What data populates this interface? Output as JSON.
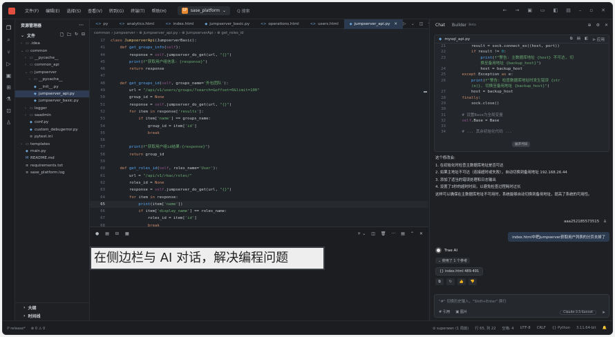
{
  "titlebar": {
    "menu": [
      "文件(F)",
      "编辑(E)",
      "选择(S)",
      "查看(V)",
      "转到(G)",
      "终端(T)",
      "帮助(H)"
    ],
    "project_initial": "SP",
    "project": "sase_platform",
    "search": "Q 搜索"
  },
  "explorer": {
    "title": "资源管理器",
    "project": "文件",
    "items": [
      {
        "label": ".idea",
        "depth": 1,
        "chev": "›",
        "icon": "folder"
      },
      {
        "label": "common",
        "depth": 1,
        "chev": "⌄",
        "icon": "folder"
      },
      {
        "label": "__pycache__",
        "depth": 2,
        "chev": "›",
        "icon": "folder"
      },
      {
        "label": "common_api",
        "depth": 2,
        "chev": "›",
        "icon": "folder"
      },
      {
        "label": "jumpserver",
        "depth": 2,
        "chev": "⌄",
        "icon": "folder"
      },
      {
        "label": "__pycache__",
        "depth": 3,
        "chev": "›",
        "icon": "folder"
      },
      {
        "label": "__init__.py",
        "depth": 3,
        "chev": "",
        "icon": "py"
      },
      {
        "label": "jumpserver_api.py",
        "depth": 3,
        "chev": "",
        "icon": "py",
        "selected": true
      },
      {
        "label": "jumpserver_basic.py",
        "depth": 3,
        "chev": "",
        "icon": "py"
      },
      {
        "label": "logger",
        "depth": 2,
        "chev": "›",
        "icon": "folder"
      },
      {
        "label": "saadmin",
        "depth": 2,
        "chev": "›",
        "icon": "folder"
      },
      {
        "label": "conf.py",
        "depth": 2,
        "chev": "",
        "icon": "py"
      },
      {
        "label": "custom_debugerror.py",
        "depth": 2,
        "chev": "",
        "icon": "py"
      },
      {
        "label": "pytest.ini",
        "depth": 2,
        "chev": "",
        "icon": "txt"
      },
      {
        "label": "templates",
        "depth": 1,
        "chev": "›",
        "icon": "folder"
      },
      {
        "label": "main.py",
        "depth": 1,
        "chev": "",
        "icon": "py"
      },
      {
        "label": "README.md",
        "depth": 1,
        "chev": "",
        "icon": "md"
      },
      {
        "label": "requirements.txt",
        "depth": 1,
        "chev": "",
        "icon": "txt"
      },
      {
        "label": "sase_platform.log",
        "depth": 1,
        "chev": "",
        "icon": "txt"
      }
    ],
    "outline": "大纲",
    "timeline": "时间线"
  },
  "editor": {
    "tabs": [
      {
        "label": "py",
        "active": false
      },
      {
        "label": "analytics.html",
        "active": false
      },
      {
        "label": "index.html",
        "active": false
      },
      {
        "label": "jumpserver_basic.py",
        "active": false
      },
      {
        "label": "operations.html",
        "active": false
      },
      {
        "label": "users.html",
        "active": false
      },
      {
        "label": "jumpserver_api.py",
        "active": true
      }
    ],
    "breadcrumb": "common › jumpserver › ⊕ jumpserver_api.py › ⊕ JumpserverApi › ⊕ get_roles_id",
    "current_line": "65",
    "lines": [
      {
        "n": "17",
        "t": [
          [
            "class ",
            "kw"
          ],
          [
            "JumpserverApi",
            "cl"
          ],
          [
            "(JumpserverBasic):",
            "ct"
          ]
        ]
      },
      {
        "n": "41",
        "t": [
          [
            "    ",
            "ct"
          ],
          [
            "def ",
            "kw"
          ],
          [
            "get_groups_info",
            "fn"
          ],
          [
            "(",
            "ct"
          ],
          [
            "self",
            "sf"
          ],
          [
            "):",
            "ct"
          ]
        ]
      },
      {
        "n": "44",
        "t": [
          [
            "        response = ",
            "ct"
          ],
          [
            "self",
            "sf"
          ],
          [
            ".jumpserver_do_get(url, ",
            "ct"
          ],
          [
            "\"{}\"",
            "st"
          ],
          [
            ")",
            "ct"
          ]
        ]
      },
      {
        "n": "45",
        "t": [
          [
            "        ",
            "ct"
          ],
          [
            "print",
            "fn"
          ],
          [
            "(",
            "ct"
          ],
          [
            "f\"获取用户组信息: {response}\"",
            "st"
          ],
          [
            ")",
            "ct"
          ]
        ]
      },
      {
        "n": "46",
        "t": [
          [
            "        ",
            "ct"
          ],
          [
            "return ",
            "kw"
          ],
          [
            "response",
            "ct"
          ]
        ]
      },
      {
        "n": "47",
        "t": [
          [
            "",
            "ct"
          ]
        ]
      },
      {
        "n": "48",
        "t": [
          [
            "    ",
            "ct"
          ],
          [
            "def ",
            "kw"
          ],
          [
            "get_groups_id",
            "fn"
          ],
          [
            "(",
            "ct"
          ],
          [
            "self",
            "sf"
          ],
          [
            ", groups_name=",
            "ct"
          ],
          [
            "'外包团队'",
            "st"
          ],
          [
            "):",
            "ct"
          ]
        ]
      },
      {
        "n": "49",
        "t": [
          [
            "        url = ",
            "ct"
          ],
          [
            "\"/api/v1/users/groups/?search=&offset=0&limit=100\"",
            "st"
          ]
        ]
      },
      {
        "n": "50",
        "t": [
          [
            "        group_id = ",
            "ct"
          ],
          [
            "None",
            "kw"
          ]
        ]
      },
      {
        "n": "51",
        "t": [
          [
            "        response = ",
            "ct"
          ],
          [
            "self",
            "sf"
          ],
          [
            ".jumpserver_do_get(url, ",
            "ct"
          ],
          [
            "\"{}\"",
            "st"
          ],
          [
            ")",
            "ct"
          ]
        ]
      },
      {
        "n": "52",
        "t": [
          [
            "        ",
            "ct"
          ],
          [
            "for ",
            "kw"
          ],
          [
            "item ",
            "ct"
          ],
          [
            "in ",
            "kw"
          ],
          [
            "response[",
            "ct"
          ],
          [
            "'results'",
            "st"
          ],
          [
            "]:",
            "ct"
          ]
        ]
      },
      {
        "n": "53",
        "t": [
          [
            "            ",
            "ct"
          ],
          [
            "if ",
            "kw"
          ],
          [
            "item[",
            "ct"
          ],
          [
            "'name'",
            "st"
          ],
          [
            "] == groups_name:",
            "ct"
          ]
        ]
      },
      {
        "n": "54",
        "t": [
          [
            "                group_id = item[",
            "ct"
          ],
          [
            "'id'",
            "st"
          ],
          [
            "]",
            "ct"
          ]
        ]
      },
      {
        "n": "55",
        "t": [
          [
            "                ",
            "ct"
          ],
          [
            "break",
            "kw"
          ]
        ]
      },
      {
        "n": "56",
        "t": [
          [
            "",
            "ct"
          ]
        ]
      },
      {
        "n": "57",
        "t": [
          [
            "        ",
            "ct"
          ],
          [
            "print",
            "fn"
          ],
          [
            "(",
            "ct"
          ],
          [
            "f\"获取用户组id结果:{response}\"",
            "st"
          ],
          [
            ")",
            "ct"
          ]
        ]
      },
      {
        "n": "58",
        "t": [
          [
            "        ",
            "ct"
          ],
          [
            "return ",
            "kw"
          ],
          [
            "group_id",
            "ct"
          ]
        ]
      },
      {
        "n": "59",
        "t": [
          [
            "",
            "ct"
          ]
        ]
      },
      {
        "n": "60",
        "t": [
          [
            "    ",
            "ct"
          ],
          [
            "def ",
            "kw"
          ],
          [
            "get_roles_id",
            "fn"
          ],
          [
            "(",
            "ct"
          ],
          [
            "self",
            "sf"
          ],
          [
            ", roles_name=",
            "ct"
          ],
          [
            "'User'",
            "st"
          ],
          [
            "):",
            "ct"
          ]
        ]
      },
      {
        "n": "61",
        "t": [
          [
            "        url = ",
            "ct"
          ],
          [
            "\"/api/v1/rbac/roles/\"",
            "st"
          ]
        ]
      },
      {
        "n": "62",
        "t": [
          [
            "        roles_id = ",
            "ct"
          ],
          [
            "None",
            "kw"
          ]
        ]
      },
      {
        "n": "63",
        "t": [
          [
            "        response = ",
            "ct"
          ],
          [
            "self",
            "sf"
          ],
          [
            ".jumpserver_do_get(url, ",
            "ct"
          ],
          [
            "\"{}\"",
            "st"
          ],
          [
            ")",
            "ct"
          ]
        ]
      },
      {
        "n": "64",
        "t": [
          [
            "        ",
            "ct"
          ],
          [
            "for ",
            "kw"
          ],
          [
            "item ",
            "ct"
          ],
          [
            "in ",
            "kw"
          ],
          [
            "response:",
            "ct"
          ]
        ]
      },
      {
        "n": "65",
        "t": [
          [
            "            ",
            "ct"
          ],
          [
            "print",
            "fn"
          ],
          [
            "(item[",
            "ct"
          ],
          [
            "'name'",
            "st"
          ],
          [
            "])",
            "ct"
          ]
        ]
      },
      {
        "n": "66",
        "t": [
          [
            "            ",
            "ct"
          ],
          [
            "if ",
            "kw"
          ],
          [
            "item[",
            "ct"
          ],
          [
            "'display_name'",
            "st"
          ],
          [
            "] == roles_name:",
            "ct"
          ]
        ]
      },
      {
        "n": "67",
        "t": [
          [
            "                roles_id = item[",
            "ct"
          ],
          [
            "'id'",
            "st"
          ],
          [
            "]",
            "ct"
          ]
        ]
      },
      {
        "n": "68",
        "t": [
          [
            "                ",
            "ct"
          ],
          [
            "break",
            "kw"
          ]
        ]
      }
    ]
  },
  "caption": "在侧边栏与 AI 对话，解决编程问题",
  "chat": {
    "tab_chat": "Chat",
    "tab_builder": "Builder",
    "beta": "Beta",
    "file": "mysql_api.py",
    "apply_label": "应用",
    "code": [
      {
        "n": "21",
        "t": [
          [
            "        result = sock.connect_ex((host, port))",
            "ct"
          ]
        ]
      },
      {
        "n": "22",
        "t": [
          [
            "        ",
            "ct"
          ],
          [
            "if ",
            "kw"
          ],
          [
            "result != ",
            "ct"
          ],
          [
            "0",
            "nm"
          ],
          [
            ":",
            "ct"
          ]
        ]
      },
      {
        "n": "23",
        "t": [
          [
            "            ",
            "ct"
          ],
          [
            "print",
            "fn"
          ],
          [
            "(",
            "ct"
          ],
          [
            "f\"警告: 主数据库地址 {host} 不可达, 切",
            "st"
          ]
        ]
      },
      {
        "n": "",
        "t": [
          [
            "            ",
            "ct"
          ],
          [
            "换至备用地址 {backup_host}\"",
            "st"
          ],
          [
            ")",
            "ct"
          ]
        ]
      },
      {
        "n": "24",
        "t": [
          [
            "            host = backup_host",
            "ct"
          ]
        ]
      },
      {
        "n": "25",
        "t": [
          [
            "    ",
            "ct"
          ],
          [
            "except ",
            "kw"
          ],
          [
            "Exception ",
            "ct"
          ],
          [
            "as ",
            "kw"
          ],
          [
            "e:",
            "ct"
          ]
        ]
      },
      {
        "n": "26",
        "t": [
          [
            "        ",
            "ct"
          ],
          [
            "print",
            "fn"
          ],
          [
            "(",
            "ct"
          ],
          [
            "f\"警告: 检查数据库地址时发生错误 {str",
            "st"
          ]
        ]
      },
      {
        "n": "",
        "t": [
          [
            "        ",
            "ct"
          ],
          [
            "(e)}, 切换至备用地址 {backup_host}\"",
            "st"
          ],
          [
            ")",
            "ct"
          ]
        ]
      },
      {
        "n": "27",
        "t": [
          [
            "        host = backup_host",
            "ct"
          ]
        ]
      },
      {
        "n": "28",
        "t": [
          [
            "    ",
            "ct"
          ],
          [
            "finally",
            "kw"
          ],
          [
            ":",
            "ct"
          ]
        ]
      },
      {
        "n": "29",
        "t": [
          [
            "        sock.close()",
            "ct"
          ]
        ]
      },
      {
        "n": "30",
        "t": [
          [
            "",
            "ct"
          ]
        ]
      },
      {
        "n": "31",
        "t": [
          [
            "    # 设置Base为全局变量",
            "cmt"
          ]
        ]
      },
      {
        "n": "32",
        "t": [
          [
            "    ",
            "ct"
          ],
          [
            "self",
            "sf"
          ],
          [
            ".Base = Base",
            "ct"
          ]
        ]
      },
      {
        "n": "33",
        "t": [
          [
            "",
            "ct"
          ]
        ]
      },
      {
        "n": "34",
        "t": [
          [
            "    # ... 其余初始化代码 ...",
            "cmt"
          ]
        ]
      }
    ],
    "expand_label": "展开代码",
    "answer_intro": "这个修改会:",
    "answer_items": [
      "1. 在初始化时检查主数据库地址是否可达",
      "2. 如果主地址不可达（连接超时或失败），自动切换到备用地址 192.168.26.44",
      "3. 添加了适当的错误处理和日志输出",
      "4. 设置了3秒的超时时间，以避免检查过程耗时过长"
    ],
    "answer_note": "这样可以确保在主数据库地址不可用时，系统能够自动切换到备用地址，提高了系统的可用性。",
    "user_name": "aaa252185573515",
    "user_message": "index.html中把jumpserver获取用户列表的分页去掉了",
    "ai_name": "Trae AI",
    "ref_label": "⌄ 使用了 1 个参考",
    "ref_file": "index.html 489-491",
    "input_placeholder": "\"#\" 切换历史输入，\"Shift+Enter\" 换行",
    "input_ref": "# 引用",
    "input_image": "▣ 图片",
    "model": "Claude-3.5-Sonnet"
  },
  "status": {
    "left": [
      "ℙ release*",
      "⊗ 0 ⚠ 0"
    ],
    "right": [
      "⊘ superwen (1 周前)",
      "行 65, 列 22",
      "空格: 4",
      "UTF-8",
      "CRLF",
      "{} Python",
      "3.11.64-bit",
      "🔔"
    ]
  },
  "colors": {
    "accent": "#2b3a4f",
    "bg": "#1f2226",
    "keyword": "#cf8e6d",
    "string": "#6aab73",
    "function": "#56a8f5"
  }
}
